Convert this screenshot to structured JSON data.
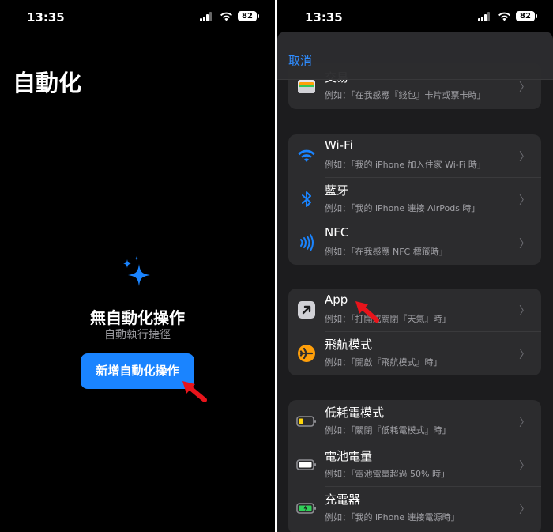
{
  "left": {
    "status": {
      "time": "13:35",
      "battery": "82"
    },
    "title": "自動化",
    "empty_title": "無自動化操作",
    "empty_subtitle": "自動執行捷徑",
    "new_button": "新增自動化操作"
  },
  "right": {
    "status": {
      "time": "13:35",
      "battery": "82"
    },
    "cancel": "取消",
    "groups": [
      {
        "rows": [
          {
            "title": "交易",
            "subtitle": "例如：「在我感應『錢包』卡片或票卡時」",
            "icon": "wallet-icon"
          }
        ]
      },
      {
        "rows": [
          {
            "title": "Wi-Fi",
            "subtitle": "例如：「我的 iPhone 加入住家 Wi-Fi 時」",
            "icon": "wifi-icon"
          },
          {
            "title": "藍牙",
            "subtitle": "例如：「我的 iPhone 連接 AirPods 時」",
            "icon": "bluetooth-icon"
          },
          {
            "title": "NFC",
            "subtitle": "例如：「在我感應 NFC 標籤時」",
            "icon": "nfc-icon"
          }
        ]
      },
      {
        "rows": [
          {
            "title": "App",
            "subtitle": "例如：「打開或關閉『天氣』時」",
            "icon": "app-arrow-icon"
          },
          {
            "title": "飛航模式",
            "subtitle": "例如：「開啟『飛航模式』時」",
            "icon": "airplane-icon"
          }
        ]
      },
      {
        "rows": [
          {
            "title": "低耗電模式",
            "subtitle": "例如：「關閉『低耗電模式』時」",
            "icon": "low-battery-icon"
          },
          {
            "title": "電池電量",
            "subtitle": "例如：「電池電量超過 50% 時」",
            "icon": "battery-level-icon"
          },
          {
            "title": "充電器",
            "subtitle": "例如：「我的 iPhone 連接電源時」",
            "icon": "charger-icon"
          }
        ]
      }
    ]
  },
  "colors": {
    "accent": "#1a84ff",
    "annotation_arrow": "#e8141b",
    "airplane": "#ff9f0a",
    "low_power": "#ffd60a",
    "charging": "#30d158"
  }
}
